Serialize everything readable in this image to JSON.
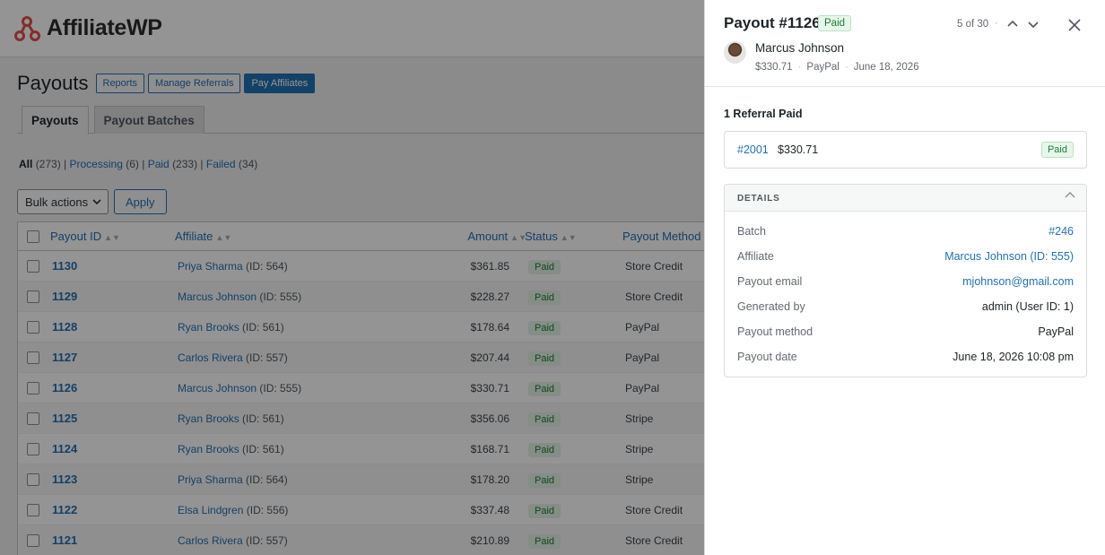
{
  "app": {
    "logo_text": "AffiliateWP",
    "page_title": "Payouts",
    "header_buttons": [
      "Reports",
      "Manage Referrals",
      "Pay Affiliates"
    ],
    "tabs": [
      "Payouts",
      "Payout Batches"
    ],
    "filters": {
      "all_label": "All",
      "all_count": "(273)",
      "processing_label": "Processing",
      "processing_count": "(6)",
      "paid_label": "Paid",
      "paid_count": "(233)",
      "failed_label": "Failed",
      "failed_count": "(34)"
    },
    "bulk_actions_label": "Bulk actions",
    "apply_label": "Apply"
  },
  "table": {
    "columns": [
      "Payout ID",
      "Affiliate",
      "Amount",
      "Status",
      "Payout Method"
    ],
    "rows": [
      {
        "id": "1130",
        "name": "Priya Sharma",
        "aff_id": "(ID: 564)",
        "amount": "$361.85",
        "status": "Paid",
        "method": "Store Credit"
      },
      {
        "id": "1129",
        "name": "Marcus Johnson",
        "aff_id": "(ID: 555)",
        "amount": "$228.27",
        "status": "Paid",
        "method": "Store Credit"
      },
      {
        "id": "1128",
        "name": "Ryan Brooks",
        "aff_id": "(ID: 561)",
        "amount": "$178.64",
        "status": "Paid",
        "method": "PayPal"
      },
      {
        "id": "1127",
        "name": "Carlos Rivera",
        "aff_id": "(ID: 557)",
        "amount": "$207.44",
        "status": "Paid",
        "method": "PayPal"
      },
      {
        "id": "1126",
        "name": "Marcus Johnson",
        "aff_id": "(ID: 555)",
        "amount": "$330.71",
        "status": "Paid",
        "method": "PayPal"
      },
      {
        "id": "1125",
        "name": "Ryan Brooks",
        "aff_id": "(ID: 561)",
        "amount": "$356.06",
        "status": "Paid",
        "method": "Stripe"
      },
      {
        "id": "1124",
        "name": "Ryan Brooks",
        "aff_id": "(ID: 561)",
        "amount": "$168.71",
        "status": "Paid",
        "method": "Stripe"
      },
      {
        "id": "1123",
        "name": "Priya Sharma",
        "aff_id": "(ID: 564)",
        "amount": "$178.20",
        "status": "Paid",
        "method": "Stripe"
      },
      {
        "id": "1122",
        "name": "Elsa Lindgren",
        "aff_id": "(ID: 556)",
        "amount": "$337.48",
        "status": "Paid",
        "method": "Store Credit"
      },
      {
        "id": "1121",
        "name": "Carlos Rivera",
        "aff_id": "(ID: 557)",
        "amount": "$210.89",
        "status": "Paid",
        "method": "Store Credit"
      }
    ]
  },
  "drawer": {
    "title": "Payout #1126",
    "status": "Paid",
    "position": "5 of 30",
    "affiliate_name": "Marcus Johnson",
    "meta_amount": "$330.71",
    "meta_method": "PayPal",
    "meta_date": "June 18, 2026",
    "referrals_heading": "1 Referral Paid",
    "referral": {
      "id": "#2001",
      "amount": "$330.71",
      "status": "Paid"
    },
    "details_title": "DETAILS",
    "details": [
      {
        "label": "Batch",
        "value": "#246",
        "link": true
      },
      {
        "label": "Affiliate",
        "value": "Marcus Johnson (ID: 555)",
        "link": true
      },
      {
        "label": "Payout email",
        "value": "mjohnson@gmail.com",
        "link": true
      },
      {
        "label": "Generated by",
        "value": "admin (User ID: 1)",
        "link": false
      },
      {
        "label": "Payout method",
        "value": "PayPal",
        "link": false
      },
      {
        "label": "Payout date",
        "value": "June 18, 2026 10:08 pm",
        "link": false
      }
    ]
  },
  "icons": {
    "logo": "affiliatewp-logo-icon",
    "nav_up": "chevron-up-icon",
    "nav_down": "chevron-down-icon",
    "close": "close-icon",
    "collapse": "chevron-up-icon"
  },
  "colors": {
    "accent": "#2271b1",
    "paid_bg": "#e7f6ea",
    "paid_text": "#1e7e34",
    "logo_red": "#e34f4f"
  }
}
